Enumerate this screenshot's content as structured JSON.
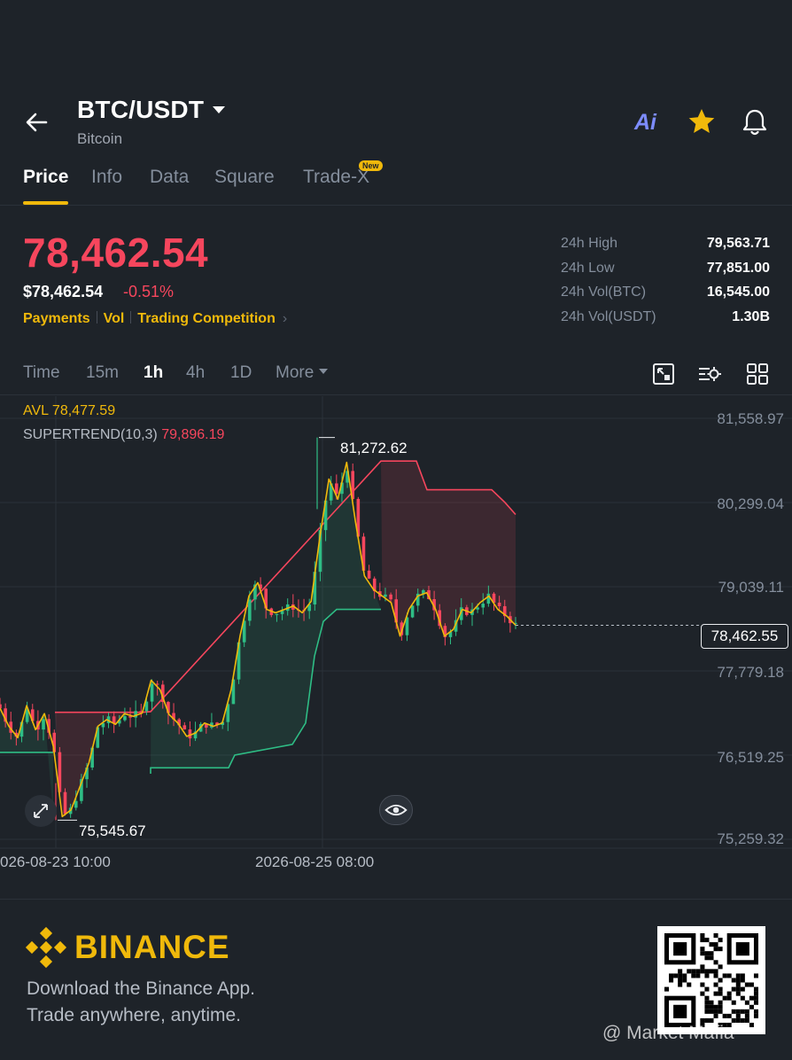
{
  "header": {
    "pair": "BTC/USDT",
    "name": "Bitcoin",
    "ai_label": "Ai"
  },
  "tabs": [
    {
      "label": "Price",
      "active": true
    },
    {
      "label": "Info"
    },
    {
      "label": "Data"
    },
    {
      "label": "Square"
    },
    {
      "label": "Trade-X",
      "badge": "New"
    }
  ],
  "price": {
    "last": "78,462.54",
    "usd": "$78,462.54",
    "change": "-0.51%",
    "links": [
      "Payments",
      "Vol",
      "Trading Competition"
    ]
  },
  "stats": [
    {
      "label": "24h High",
      "value": "79,563.71"
    },
    {
      "label": "24h Low",
      "value": "77,851.00"
    },
    {
      "label": "24h Vol(BTC)",
      "value": "16,545.00"
    },
    {
      "label": "24h Vol(USDT)",
      "value": "1.30B"
    }
  ],
  "timeframes": {
    "items": [
      "Time",
      "15m",
      "1h",
      "4h",
      "1D"
    ],
    "active": "1h",
    "more": "More"
  },
  "indicators": {
    "avl_label": "AVL",
    "avl_value": "78,477.59",
    "supertrend_label": "SUPERTREND(10,3)",
    "supertrend_value": "79,896.19"
  },
  "chart_data": {
    "type": "candlestick",
    "y_ticks": [
      "81,558.97",
      "80,299.04",
      "79,039.11",
      "77,779.18",
      "76,519.25",
      "75,259.32"
    ],
    "ylim": [
      75259.32,
      81558.97
    ],
    "x_ticks": [
      "026-08-23 10:00",
      "2026-08-25 08:00"
    ],
    "current_price": "78,462.55",
    "high_label": "81,272.62",
    "low_label": "75,545.67",
    "colors": {
      "up": "#2ebd85",
      "down": "#f6465d",
      "avl": "#f0b90b",
      "grid": "#2b3139"
    },
    "close_path": [
      77220,
      76950,
      76780,
      77260,
      76900,
      77140,
      76650,
      75600,
      75700,
      76050,
      76400,
      76950,
      77050,
      76980,
      77140,
      77100,
      77150,
      77640,
      77500,
      77130,
      77000,
      76800,
      76850,
      77000,
      76950,
      77000,
      77500,
      78300,
      78900,
      79100,
      78700,
      78650,
      78700,
      78750,
      78650,
      78820,
      79800,
      80650,
      80350,
      80900,
      80000,
      79200,
      79000,
      78900,
      78800,
      78300,
      78700,
      78900,
      78950,
      78700,
      78300,
      78400,
      78700,
      78650,
      78800,
      78900,
      78700,
      78600,
      78462.55
    ],
    "supertrend": {
      "bullish": [
        [
          0,
          76560
        ],
        [
          60,
          76560
        ],
        [
          60,
          75650
        ],
        [
          62,
          75650
        ],
        [
          170,
          76240
        ],
        [
          170,
          76330
        ],
        [
          258,
          76330
        ],
        [
          265,
          76520
        ],
        [
          330,
          76680
        ],
        [
          345,
          77000
        ],
        [
          355,
          78000
        ],
        [
          365,
          78520
        ],
        [
          380,
          78700
        ],
        [
          430,
          78700
        ]
      ],
      "bearish": [
        [
          62,
          77160
        ],
        [
          160,
          77160
        ],
        [
          170,
          77170
        ],
        [
          430,
          80920
        ],
        [
          470,
          80920
        ],
        [
          482,
          80490
        ],
        [
          555,
          80490
        ],
        [
          570,
          80300
        ],
        [
          582,
          80120
        ]
      ]
    }
  },
  "footer": {
    "brand": "BINANCE",
    "tagline1": "Download the Binance App.",
    "tagline2": "Trade anywhere, anytime.",
    "watermark": "@ Market Mafia"
  }
}
